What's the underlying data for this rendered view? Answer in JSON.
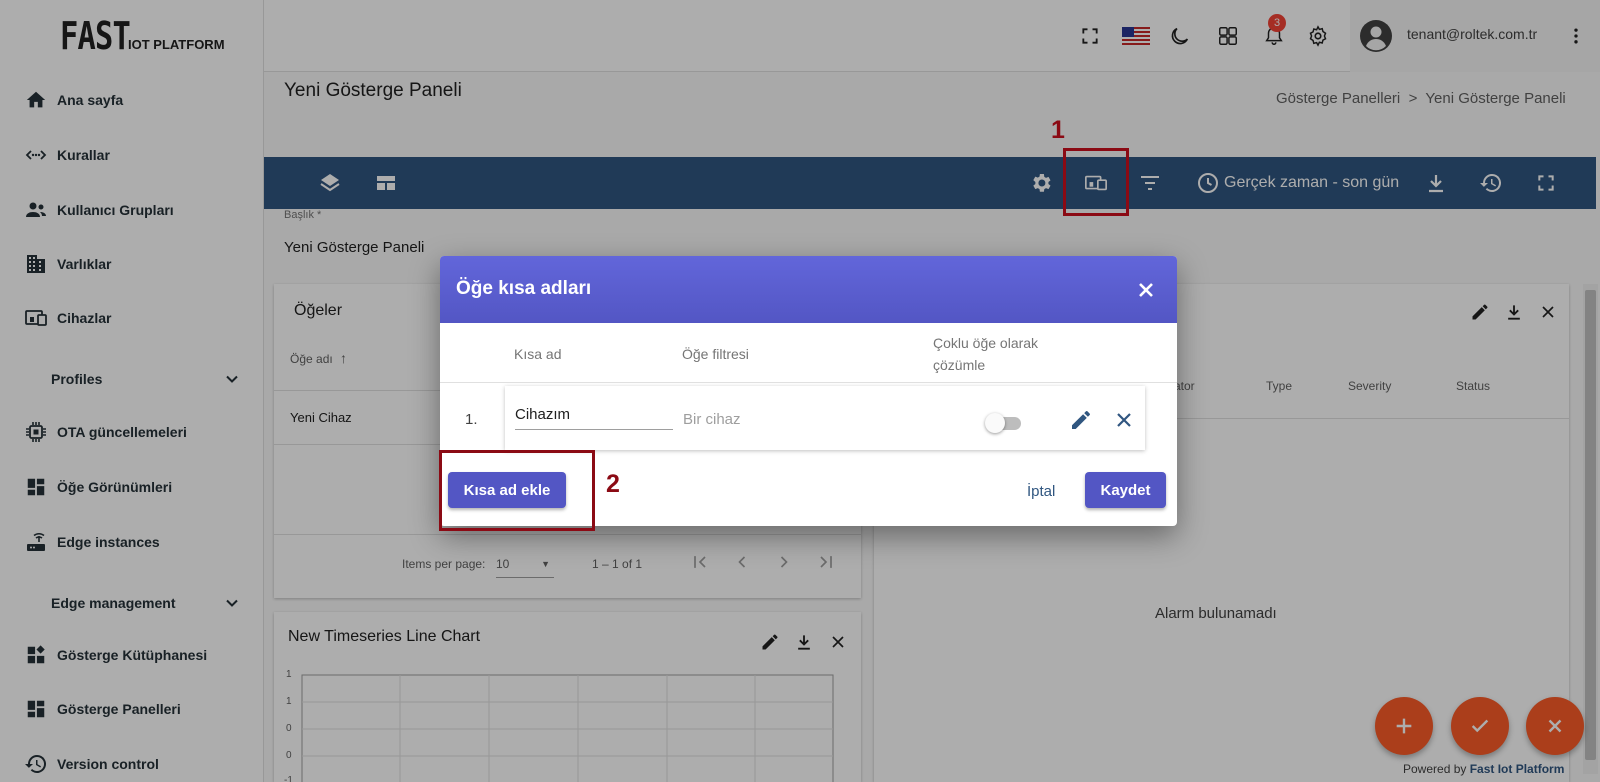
{
  "sidebar": {
    "logo_big": "FAST",
    "logo_small": "IOT PLATFORM",
    "items": [
      {
        "label": "Ana sayfa",
        "icon": "home-icon"
      },
      {
        "label": "Kurallar",
        "icon": "rule-chain-icon"
      },
      {
        "label": "Kullanıcı Grupları",
        "icon": "user-group-icon"
      },
      {
        "label": "Varlıklar",
        "icon": "building-icon"
      },
      {
        "label": "Cihazlar",
        "icon": "devices-icon"
      },
      {
        "label": "Profiles",
        "icon": "chevron-down-icon"
      },
      {
        "label": "OTA güncellemeleri",
        "icon": "chip-icon"
      },
      {
        "label": "Öğe Görünümleri",
        "icon": "dashboard-icon"
      },
      {
        "label": "Edge instances",
        "icon": "router-icon"
      },
      {
        "label": "Edge management",
        "icon": "chevron-down-icon"
      },
      {
        "label": "Gösterge Kütüphanesi",
        "icon": "widgets-icon"
      },
      {
        "label": "Gösterge Panelleri",
        "icon": "dashboard-icon"
      },
      {
        "label": "Version control",
        "icon": "history-icon"
      }
    ]
  },
  "topbar": {
    "notification_count": "3",
    "user_email": "tenant@roltek.com.tr"
  },
  "header": {
    "title": "Yeni Gösterge Paneli",
    "breadcrumb": "Gösterge Panelleri  >  Yeni Gösterge Paneli"
  },
  "toolbar": {
    "timewindow": "Gerçek zaman - son gün"
  },
  "title_field": {
    "label": "Başlık *",
    "value": "Yeni Gösterge Paneli"
  },
  "entities_widget": {
    "title": "Öğeler",
    "column": "Öğe adı",
    "row": "Yeni Cihaz",
    "items_per_page_label": "Items per page:",
    "items_per_page": "10",
    "range": "1 – 1 of 1"
  },
  "alarms_widget": {
    "columns": [
      "ator",
      "Type",
      "Severity",
      "Status"
    ],
    "empty": "Alarm bulunamadı"
  },
  "chart_widget": {
    "title": "New Timeseries Line Chart",
    "y_ticks": [
      "1",
      "1",
      "0",
      "0",
      "-1"
    ]
  },
  "dialog": {
    "title": "Öğe kısa adları",
    "col_alias": "Kısa ad",
    "col_filter": "Öğe filtresi",
    "col_multi_line1": "Çoklu öğe olarak",
    "col_multi_line2": "çözümle",
    "row_num": "1.",
    "alias_value": "Cihazım",
    "filter_value": "Bir cihaz",
    "add_button": "Kısa ad ekle",
    "cancel_button": "İptal",
    "save_button": "Kaydet"
  },
  "annotations": {
    "one": "1",
    "two": "2"
  },
  "footer": {
    "powered_prefix": "Powered by",
    "powered_brand": "Fast Iot Platform"
  },
  "colors": {
    "toolbar": "#305680",
    "dialog_header": "#5c5fd0",
    "fab": "#fc5c28",
    "annotation": "#8b0a14"
  }
}
